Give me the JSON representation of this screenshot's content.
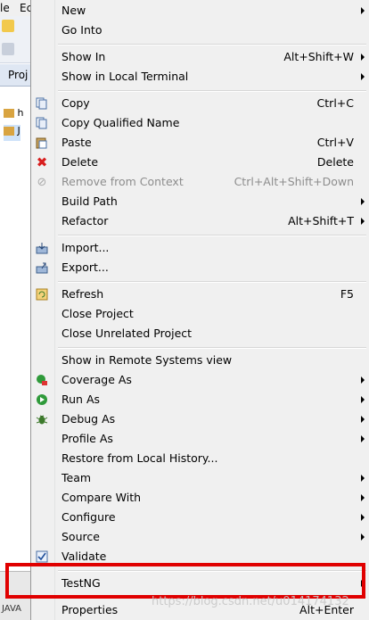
{
  "background_ide": {
    "menubar": [
      "le",
      "Ec"
    ],
    "tab_label": "Proj",
    "tree_rows": [
      "h",
      "J"
    ],
    "bottom_text": "JAVA"
  },
  "menu": {
    "items": [
      {
        "label": "New",
        "submenu": true
      },
      {
        "label": "Go Into"
      },
      {
        "label": "Show In",
        "accel": "Alt+Shift+W",
        "submenu": true
      },
      {
        "label": "Show in Local Terminal",
        "submenu": true
      },
      {
        "label": "Copy",
        "accel": "Ctrl+C",
        "icon": "copy-icon"
      },
      {
        "label": "Copy Qualified Name",
        "icon": "copy-qualified-name-icon"
      },
      {
        "label": "Paste",
        "accel": "Ctrl+V",
        "icon": "paste-icon"
      },
      {
        "label": "Delete",
        "accel": "Delete",
        "icon": "delete-icon"
      },
      {
        "label": "Remove from Context",
        "accel": "Ctrl+Alt+Shift+Down",
        "disabled": true,
        "icon": "remove-from-context-icon"
      },
      {
        "label": "Build Path",
        "submenu": true
      },
      {
        "label": "Refactor",
        "accel": "Alt+Shift+T",
        "submenu": true
      },
      {
        "label": "Import...",
        "icon": "import-icon"
      },
      {
        "label": "Export...",
        "icon": "export-icon"
      },
      {
        "label": "Refresh",
        "accel": "F5",
        "icon": "refresh-icon"
      },
      {
        "label": "Close Project"
      },
      {
        "label": "Close Unrelated Project"
      },
      {
        "label": "Show in Remote Systems view"
      },
      {
        "label": "Coverage As",
        "submenu": true,
        "icon": "coverage-icon"
      },
      {
        "label": "Run As",
        "submenu": true,
        "icon": "run-icon"
      },
      {
        "label": "Debug As",
        "submenu": true,
        "icon": "debug-bug-icon"
      },
      {
        "label": "Profile As",
        "submenu": true
      },
      {
        "label": "Restore from Local History..."
      },
      {
        "label": "Team",
        "submenu": true
      },
      {
        "label": "Compare With",
        "submenu": true
      },
      {
        "label": "Configure",
        "submenu": true
      },
      {
        "label": "Source",
        "submenu": true
      },
      {
        "label": "Validate",
        "icon": "validate-check-icon"
      },
      {
        "label": "TestNG",
        "submenu": true
      },
      {
        "label": "Properties",
        "accel": "Alt+Enter"
      }
    ]
  },
  "watermark": "https://blog.csdn.net/u014174132"
}
